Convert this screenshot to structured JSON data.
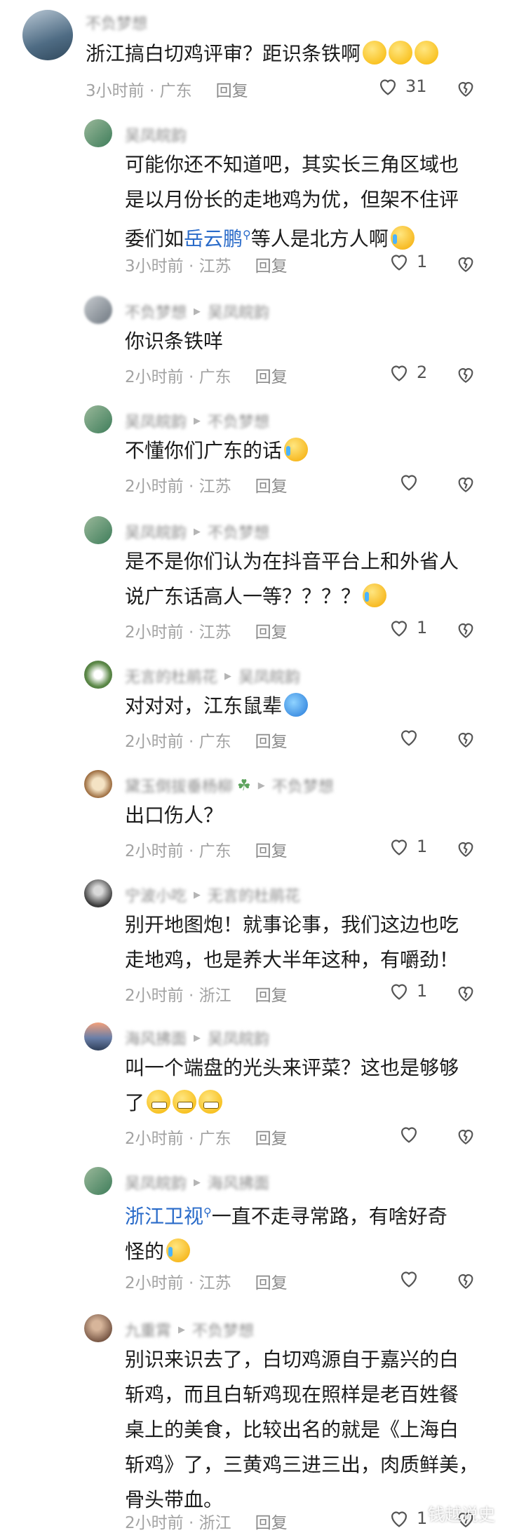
{
  "comments": [
    {
      "user": "不负梦想",
      "text": [
        "浙江搞白切鸡评审？距识条铁啊"
      ],
      "emojis": 3,
      "time": "3小时前",
      "location": "广东",
      "reply_label": "回复",
      "likes": "31"
    },
    {
      "user": "吴凤皖韵",
      "text": [
        "可能你还不知道吧，其实长三角区域也",
        "是以月份长的走地鸡为优，但架不住评",
        "委们如",
        "岳云鹏",
        "等人是北方人啊"
      ],
      "time": "3小时前",
      "location": "江苏",
      "reply_label": "回复",
      "likes": "1"
    },
    {
      "user": "不负梦想",
      "reply_to": "吴凤皖韵",
      "text": [
        "你识条铁咩"
      ],
      "time": "2小时前",
      "location": "广东",
      "reply_label": "回复",
      "likes": "2"
    },
    {
      "user": "吴凤皖韵",
      "reply_to": "不负梦想",
      "text": [
        "不懂你们广东的话"
      ],
      "time": "2小时前",
      "location": "江苏",
      "reply_label": "回复",
      "likes": ""
    },
    {
      "user": "吴凤皖韵",
      "reply_to": "不负梦想",
      "text": [
        "是不是你们认为在抖音平台上和外省人",
        "说广东话高人一等？？？？"
      ],
      "time": "2小时前",
      "location": "江苏",
      "reply_label": "回复",
      "likes": "1"
    },
    {
      "user": "无言的杜鹃花",
      "reply_to": "吴凤皖韵",
      "text": [
        "对对对，江东鼠辈"
      ],
      "time": "2小时前",
      "location": "广东",
      "reply_label": "回复",
      "likes": ""
    },
    {
      "user": "黛玉倒拔垂杨柳",
      "reply_to": "不负梦想",
      "text": [
        "出口伤人？"
      ],
      "time": "2小时前",
      "location": "广东",
      "reply_label": "回复",
      "likes": "1"
    },
    {
      "user": "宁波小吃",
      "reply_to": "无言的杜鹃花",
      "text": [
        "别开地图炮！就事论事，我们这边也吃",
        "走地鸡，也是养大半年这种，有嚼劲！"
      ],
      "time": "2小时前",
      "location": "浙江",
      "reply_label": "回复",
      "likes": "1"
    },
    {
      "user": "海风拂面",
      "reply_to": "吴凤皖韵",
      "text": [
        "叫一个端盘的光头来评菜？这也是够够",
        "了"
      ],
      "time": "2小时前",
      "location": "广东",
      "reply_label": "回复",
      "likes": ""
    },
    {
      "user": "吴凤皖韵",
      "reply_to": "海风拂面",
      "text": [
        "浙江卫视",
        "一直不走寻常路，有啥好奇",
        "怪的"
      ],
      "time": "2小时前",
      "location": "江苏",
      "reply_label": "回复",
      "likes": ""
    },
    {
      "user": "九重霄",
      "reply_to": "不负梦想",
      "text": [
        "别识来识去了，白切鸡源自于嘉兴的白",
        "斩鸡，而且白斩鸡现在照样是老百姓餐",
        "桌上的美食，比较出名的就是《上海白",
        "斩鸡》了，三黄鸡三进三出，肉质鲜美，",
        "骨头带血。"
      ],
      "time": "2小时前",
      "location": "浙江",
      "reply_label": "回复",
      "likes": "1"
    }
  ],
  "separator": "·",
  "watermark": "钱越说史",
  "icon_names": {
    "like": "heart-outline-icon",
    "dislike": "broken-heart-icon",
    "reply_arrow": "triangle-right-icon"
  }
}
